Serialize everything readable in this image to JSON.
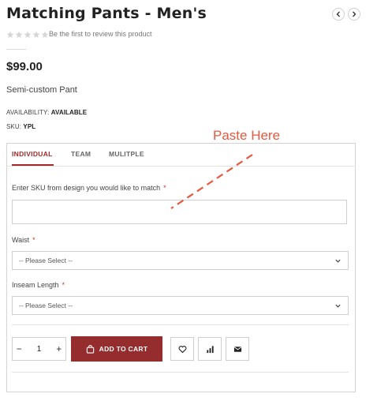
{
  "product": {
    "title": "Matching Pants - Men's",
    "rating_stars": 0,
    "rating_max": 5,
    "review_prompt": "Be the first to review this product",
    "price": "$99.00",
    "description": "Semi-custom Pant",
    "availability_label": "AVAILABILITY:",
    "availability_value": "AVAILABLE",
    "sku_label": "SKU:",
    "sku_value": "YPL"
  },
  "nav": {
    "prev_icon": "chevron-left-icon",
    "next_icon": "chevron-right-icon"
  },
  "annotation": {
    "text": "Paste Here",
    "color": "#e4593f"
  },
  "tabs": [
    {
      "label": "INDIVIDUAL",
      "active": true
    },
    {
      "label": "TEAM",
      "active": false
    },
    {
      "label": "MULITPLE",
      "active": false
    }
  ],
  "form": {
    "sku_label": "Enter SKU from design you would like to match",
    "sku_value": "",
    "waist_label": "Waist",
    "waist_selected": "-- Please Select --",
    "inseam_label": "Inseam Length",
    "inseam_selected": "-- Please Select --",
    "required_mark": "*"
  },
  "cart": {
    "qty_minus": "−",
    "qty_value": "1",
    "qty_plus": "+",
    "add_to_cart": "ADD TO CART",
    "icons": [
      "shopping-bag-icon",
      "heart-icon",
      "bar-chart-icon",
      "envelope-icon"
    ]
  },
  "colors": {
    "accent": "#a12b2b",
    "cart_button": "#952d2f",
    "text": "#222222"
  }
}
